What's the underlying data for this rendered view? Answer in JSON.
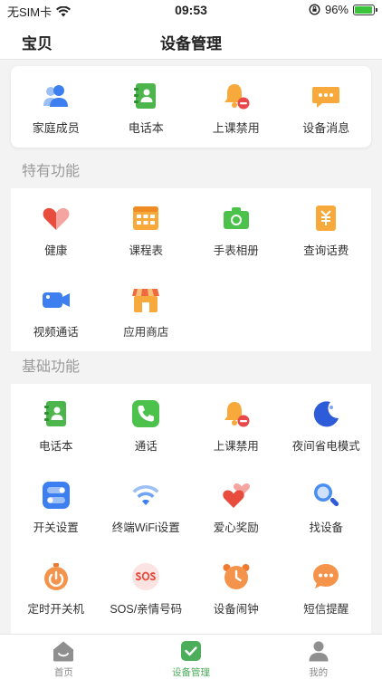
{
  "status_bar": {
    "carrier": "无SIM卡",
    "time": "09:53",
    "battery_percent": "96%",
    "battery_level": 0.96
  },
  "nav": {
    "back_label": "宝贝",
    "title": "设备管理"
  },
  "quick_actions": [
    {
      "label": "家庭成员",
      "icon": "family-members-icon"
    },
    {
      "label": "电话本",
      "icon": "phonebook-icon"
    },
    {
      "label": "上课禁用",
      "icon": "class-disable-bell-icon"
    },
    {
      "label": "设备消息",
      "icon": "device-message-icon"
    }
  ],
  "special_section": {
    "title": "特有功能",
    "items": [
      {
        "label": "健康",
        "icon": "health-heart-icon"
      },
      {
        "label": "课程表",
        "icon": "schedule-icon"
      },
      {
        "label": "手表相册",
        "icon": "camera-album-icon"
      },
      {
        "label": "查询话费",
        "icon": "bill-query-icon"
      },
      {
        "label": "视频通话",
        "icon": "video-call-icon"
      },
      {
        "label": "应用商店",
        "icon": "app-store-icon"
      }
    ]
  },
  "basic_section": {
    "title": "基础功能",
    "items": [
      {
        "label": "电话本",
        "icon": "phonebook-icon"
      },
      {
        "label": "通话",
        "icon": "call-icon"
      },
      {
        "label": "上课禁用",
        "icon": "class-disable-bell-icon"
      },
      {
        "label": "夜间省电模式",
        "icon": "night-mode-icon"
      },
      {
        "label": "开关设置",
        "icon": "switch-settings-icon"
      },
      {
        "label": "终端WiFi设置",
        "icon": "wifi-icon"
      },
      {
        "label": "爱心奖励",
        "icon": "love-reward-icon"
      },
      {
        "label": "找设备",
        "icon": "find-device-icon"
      },
      {
        "label": "定时开关机",
        "icon": "timer-power-icon"
      },
      {
        "label": "SOS/亲情号码",
        "icon": "sos-icon"
      },
      {
        "label": "设备闹钟",
        "icon": "alarm-clock-icon"
      },
      {
        "label": "短信提醒",
        "icon": "sms-reminder-icon"
      }
    ]
  },
  "tabbar": [
    {
      "label": "首页",
      "icon": "home-icon",
      "active": false
    },
    {
      "label": "设备管理",
      "icon": "device-manage-icon",
      "active": true
    },
    {
      "label": "我的",
      "icon": "profile-icon",
      "active": false
    }
  ],
  "colors": {
    "accent_green": "#4cae5a",
    "section_header_text": "#9a9a9a",
    "background": "#f3f3f3"
  }
}
